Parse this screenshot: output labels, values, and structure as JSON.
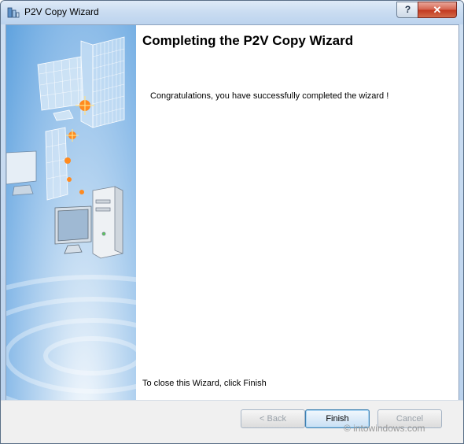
{
  "window": {
    "title": "P2V Copy Wizard",
    "help_label": "?",
    "close_label": "✕"
  },
  "content": {
    "heading": "Completing the P2V Copy Wizard",
    "message": "Congratulations, you have successfully completed the wizard !",
    "close_hint": "To close this Wizard, click Finish"
  },
  "buttons": {
    "back": "< Back",
    "finish": "Finish",
    "cancel": "Cancel"
  },
  "watermark": "© intowindows.com",
  "colors": {
    "side_panel": "#8ebde9",
    "default_button_border": "#3c7fb1",
    "close_button": "#c2381f"
  }
}
